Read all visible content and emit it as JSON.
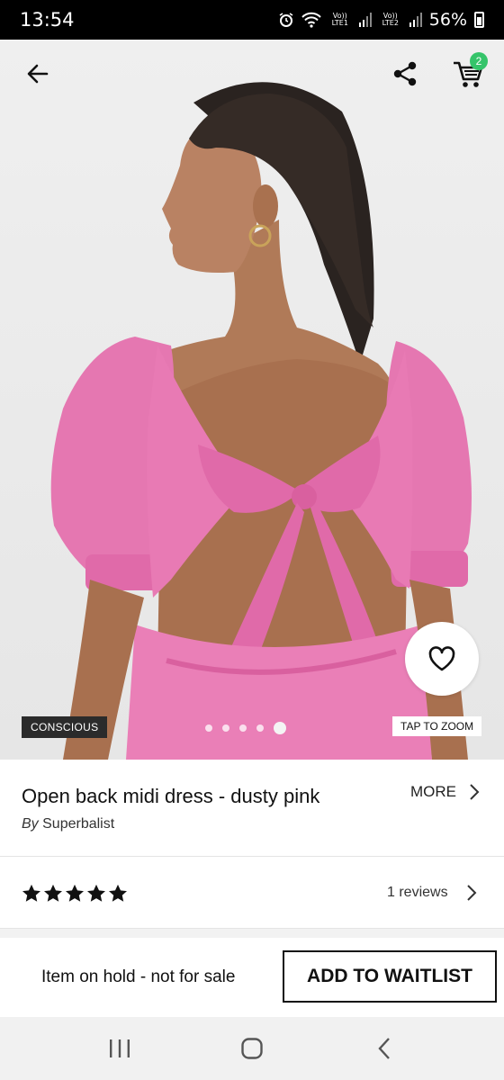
{
  "status_bar": {
    "time": "13:54",
    "network_1": "Vo)) LTE1",
    "network_2": "Vo)) LTE2",
    "battery": "56%",
    "icons": [
      "alarm-icon",
      "wifi-icon",
      "signal-icon",
      "battery-icon"
    ]
  },
  "header": {
    "back_icon": "arrow-left-icon",
    "share_icon": "share-icon",
    "cart_icon": "cart-icon",
    "cart_count": "2"
  },
  "gallery": {
    "badge": "CONSCIOUS",
    "zoom_hint": "TAP TO ZOOM",
    "total_images": 5,
    "active_index": 4,
    "wishlist_icon": "heart-icon"
  },
  "product": {
    "title": "Open back midi dress - dusty pink",
    "by_label": "By",
    "brand": "Superbalist",
    "more_label": "MORE"
  },
  "reviews": {
    "rating": 5,
    "max_rating": 5,
    "count_label": "1 reviews"
  },
  "purchase": {
    "hold_text": "Item on hold - not for sale",
    "waitlist_label": "ADD TO WAITLIST"
  },
  "nav": {
    "icons": [
      "recent-apps-icon",
      "home-icon",
      "back-icon"
    ]
  },
  "colors": {
    "dress_pink": "#e879b4",
    "cart_badge": "#35c46a",
    "status_bar": "#000000"
  }
}
